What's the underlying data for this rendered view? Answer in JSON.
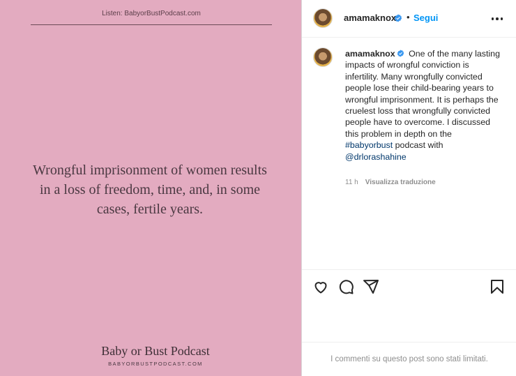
{
  "post_image": {
    "header": "Listen: BabyorBustPodcast.com",
    "quote": "Wrongful imprisonment of women results in a loss of freedom, time, and, in some cases, fertile years.",
    "footer_title": "Baby or Bust Podcast",
    "footer_url": "BABYORBUSTPODCAST.COM",
    "background_color": "#e3abc0"
  },
  "header": {
    "username": "amamaknox",
    "separator": "•",
    "follow_label": "Segui",
    "more_icon": "more-horizontal-icon"
  },
  "caption": {
    "username": "amamaknox",
    "text": "One of the many lasting impacts of wrongful conviction is infertility. Many wrongfully convicted people lose their child-bearing years to wrongful imprisonment. It is perhaps the cruelest loss that wrongfully convicted people have to overcome. I discussed this problem in depth on the",
    "hashtag": "#babyorbust",
    "text_after": "podcast with",
    "mention": "@drlorashahine",
    "time": "11 h",
    "translate_label": "Visualizza traduzione"
  },
  "actions": {
    "like_icon": "heart-icon",
    "comment_icon": "comment-icon",
    "share_icon": "share-icon",
    "save_icon": "bookmark-icon"
  },
  "comments": {
    "limited_text": "I commenti su questo post sono stati limitati."
  },
  "colors": {
    "accent": "#0095f6",
    "verified": "#3897f0",
    "link": "#00376b",
    "muted": "#8e8e8e"
  }
}
